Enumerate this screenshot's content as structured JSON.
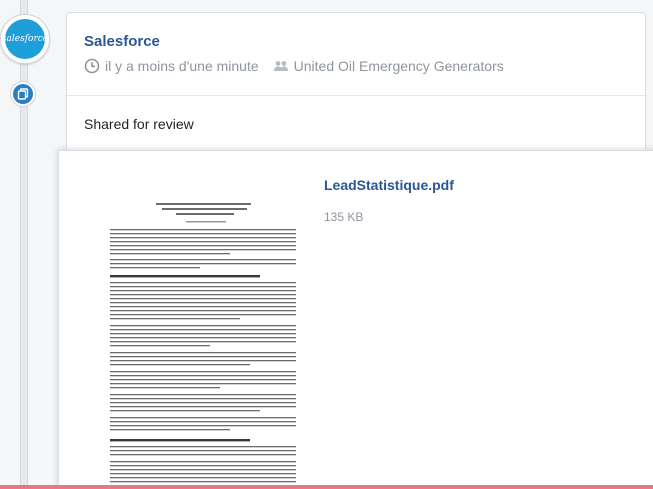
{
  "avatar": {
    "brand_text": "salesforce"
  },
  "post": {
    "author": "Salesforce",
    "timestamp": "il y a moins d'une minute",
    "record": "United Oil Emergency Generators",
    "body": "Shared for review"
  },
  "attachment": {
    "file_name": "LeadStatistique.pdf",
    "file_size": "135 KB"
  },
  "colors": {
    "link": "#2b5797",
    "meta": "#8e959d",
    "brand": "#1f9fd9",
    "accent_bar": "#e57a86"
  },
  "icons": {
    "time": "clock-icon",
    "record": "group-icon",
    "type": "file-copy-icon"
  }
}
